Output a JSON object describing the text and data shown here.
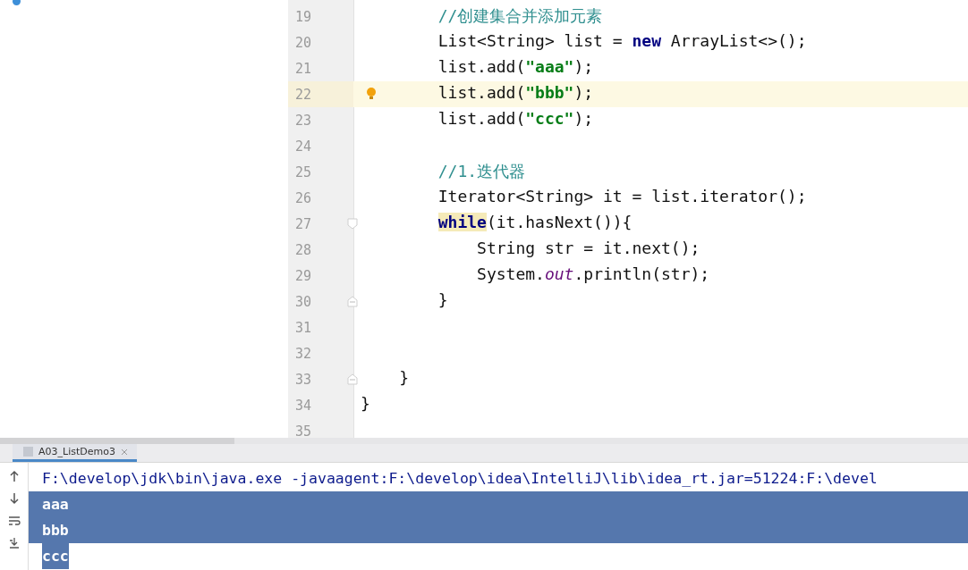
{
  "editor": {
    "lines": [
      {
        "children": [
          {
            "children": [
              {
                "number": "19",
                "kind": "plain",
                "current": false,
                "tokens": [
                  {
                    "kind": "comment",
                    "text": "//创建集合并添加元素"
                  }
                ]
              },
              {
                "number": "20",
                "kind": "plain",
                "current": false,
                "tokens": [
                  {
                    "kind": "text",
                    "text": "List<String> list = "
                  },
                  {
                    "kind": "keyword",
                    "text": "new"
                  },
                  {
                    "kind": "text",
                    "text": " ArrayList<>();"
                  }
                ]
              },
              {
                "number": "21",
                "kind": "plain",
                "current": false,
                "tokens": [
                  {
                    "kind": "text",
                    "text": "list.add("
                  },
                  {
                    "kind": "string",
                    "text": "\"aaa\""
                  },
                  {
                    "kind": "text",
                    "text": ");"
                  }
                ]
              },
              {
                "number": "22",
                "kind": "plain",
                "current": true,
                "bulb": true,
                "tokens": [
                  {
                    "kind": "text",
                    "text": "list.add("
                  },
                  {
                    "kind": "string",
                    "text": "\"bbb\""
                  },
                  {
                    "kind": "text",
                    "text": ");"
                  }
                ]
              },
              {
                "number": "23",
                "kind": "plain",
                "current": false,
                "tokens": [
                  {
                    "kind": "text",
                    "text": "list.add("
                  },
                  {
                    "kind": "string",
                    "text": "\"ccc\""
                  },
                  {
                    "kind": "text",
                    "text": ");"
                  }
                ]
              },
              {
                "number": "24",
                "kind": "plain",
                "current": false
              },
              {
                "number": "25",
                "kind": "plain",
                "current": false,
                "tokens": [
                  {
                    "kind": "comment",
                    "text": "//1.迭代器"
                  }
                ]
              },
              {
                "number": "26",
                "kind": "plain",
                "current": false,
                "tokens": [
                  {
                    "kind": "text",
                    "text": "Iterator<String> it = list.iterator();"
                  }
                ]
              },
              {
                "number": "27",
                "kind": "fold-start",
                "current": false,
                "tokens": [
                  {
                    "kind": "keyword-match",
                    "text": "while"
                  },
                  {
                    "kind": "text",
                    "text": "(it.hasNext()){"
                  }
                ],
                "children": [
                  {
                    "number": "28",
                    "kind": "plain",
                    "current": false,
                    "tokens": [
                      {
                        "kind": "text",
                        "text": "String str = it.next();"
                      }
                    ]
                  },
                  {
                    "number": "29",
                    "kind": "plain",
                    "current": false,
                    "tokens": [
                      {
                        "kind": "text",
                        "text": "System."
                      },
                      {
                        "kind": "static",
                        "text": "out"
                      },
                      {
                        "kind": "text",
                        "text": ".println(str);"
                      }
                    ]
                  }
                ]
              },
              {
                "number": "30",
                "kind": "fold-end",
                "current": false,
                "tokens": [
                  {
                    "kind": "text",
                    "text": "}"
                  }
                ]
              },
              {
                "number": "31",
                "kind": "plain",
                "current": false
              },
              {
                "number": "32",
                "kind": "plain",
                "current": false
              }
            ]
          },
          {
            "number": "33",
            "kind": "fold-end",
            "current": false,
            "tokens": [
              {
                "kind": "text",
                "text": "}"
              }
            ]
          }
        ]
      },
      {
        "number": "34",
        "kind": "plain",
        "current": false,
        "tokens": [
          {
            "kind": "text",
            "text": "}"
          }
        ]
      },
      {
        "number": "35",
        "kind": "plain",
        "current": false
      }
    ]
  },
  "run_tabs": [
    {
      "label": "A03_ListDemo3",
      "selected": true
    }
  ],
  "console": {
    "lines": [
      {
        "text": "F:\\develop\\jdk\\bin\\java.exe -javaagent:F:\\develop\\idea\\IntelliJ\\lib\\idea_rt.jar=51224:F:\\devel",
        "kind": "full",
        "selected": false
      },
      {
        "text": "aaa",
        "kind": "full",
        "selected": true
      },
      {
        "text": "bbb",
        "kind": "full",
        "selected": true
      },
      {
        "text": "ccc",
        "kind": "partial",
        "selected": true
      }
    ]
  }
}
